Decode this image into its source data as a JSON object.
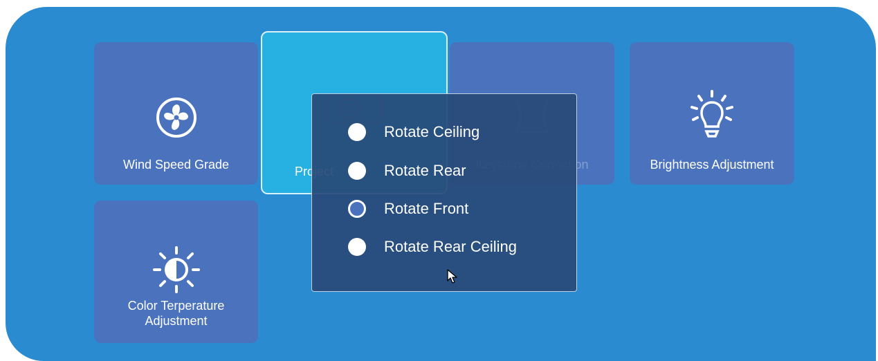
{
  "tiles": [
    {
      "label": "Wind Speed Grade",
      "icon": "fan-icon"
    },
    {
      "label": "Projection Mode",
      "visible_label": "Project",
      "icon": "projector-icon"
    },
    {
      "label": "Keystone Correction",
      "icon": "keystone-icon"
    },
    {
      "label": "Brightness Adjustment",
      "icon": "lightbulb-icon"
    },
    {
      "label_line1": "Color Terperature",
      "label_line2": "Adjustment",
      "icon": "contrast-sun-icon"
    }
  ],
  "dialog": {
    "options": [
      {
        "label": "Rotate Ceiling",
        "checked": false
      },
      {
        "label": "Rotate Rear",
        "checked": false
      },
      {
        "label": "Rotate Front",
        "checked": true
      },
      {
        "label": "Rotate Rear Ceiling",
        "checked": false
      }
    ]
  },
  "colors": {
    "background": "#2a8bd0",
    "tile": "#4b73bd",
    "tile_selected": "#27b0e2",
    "dialog": "#284a78"
  }
}
